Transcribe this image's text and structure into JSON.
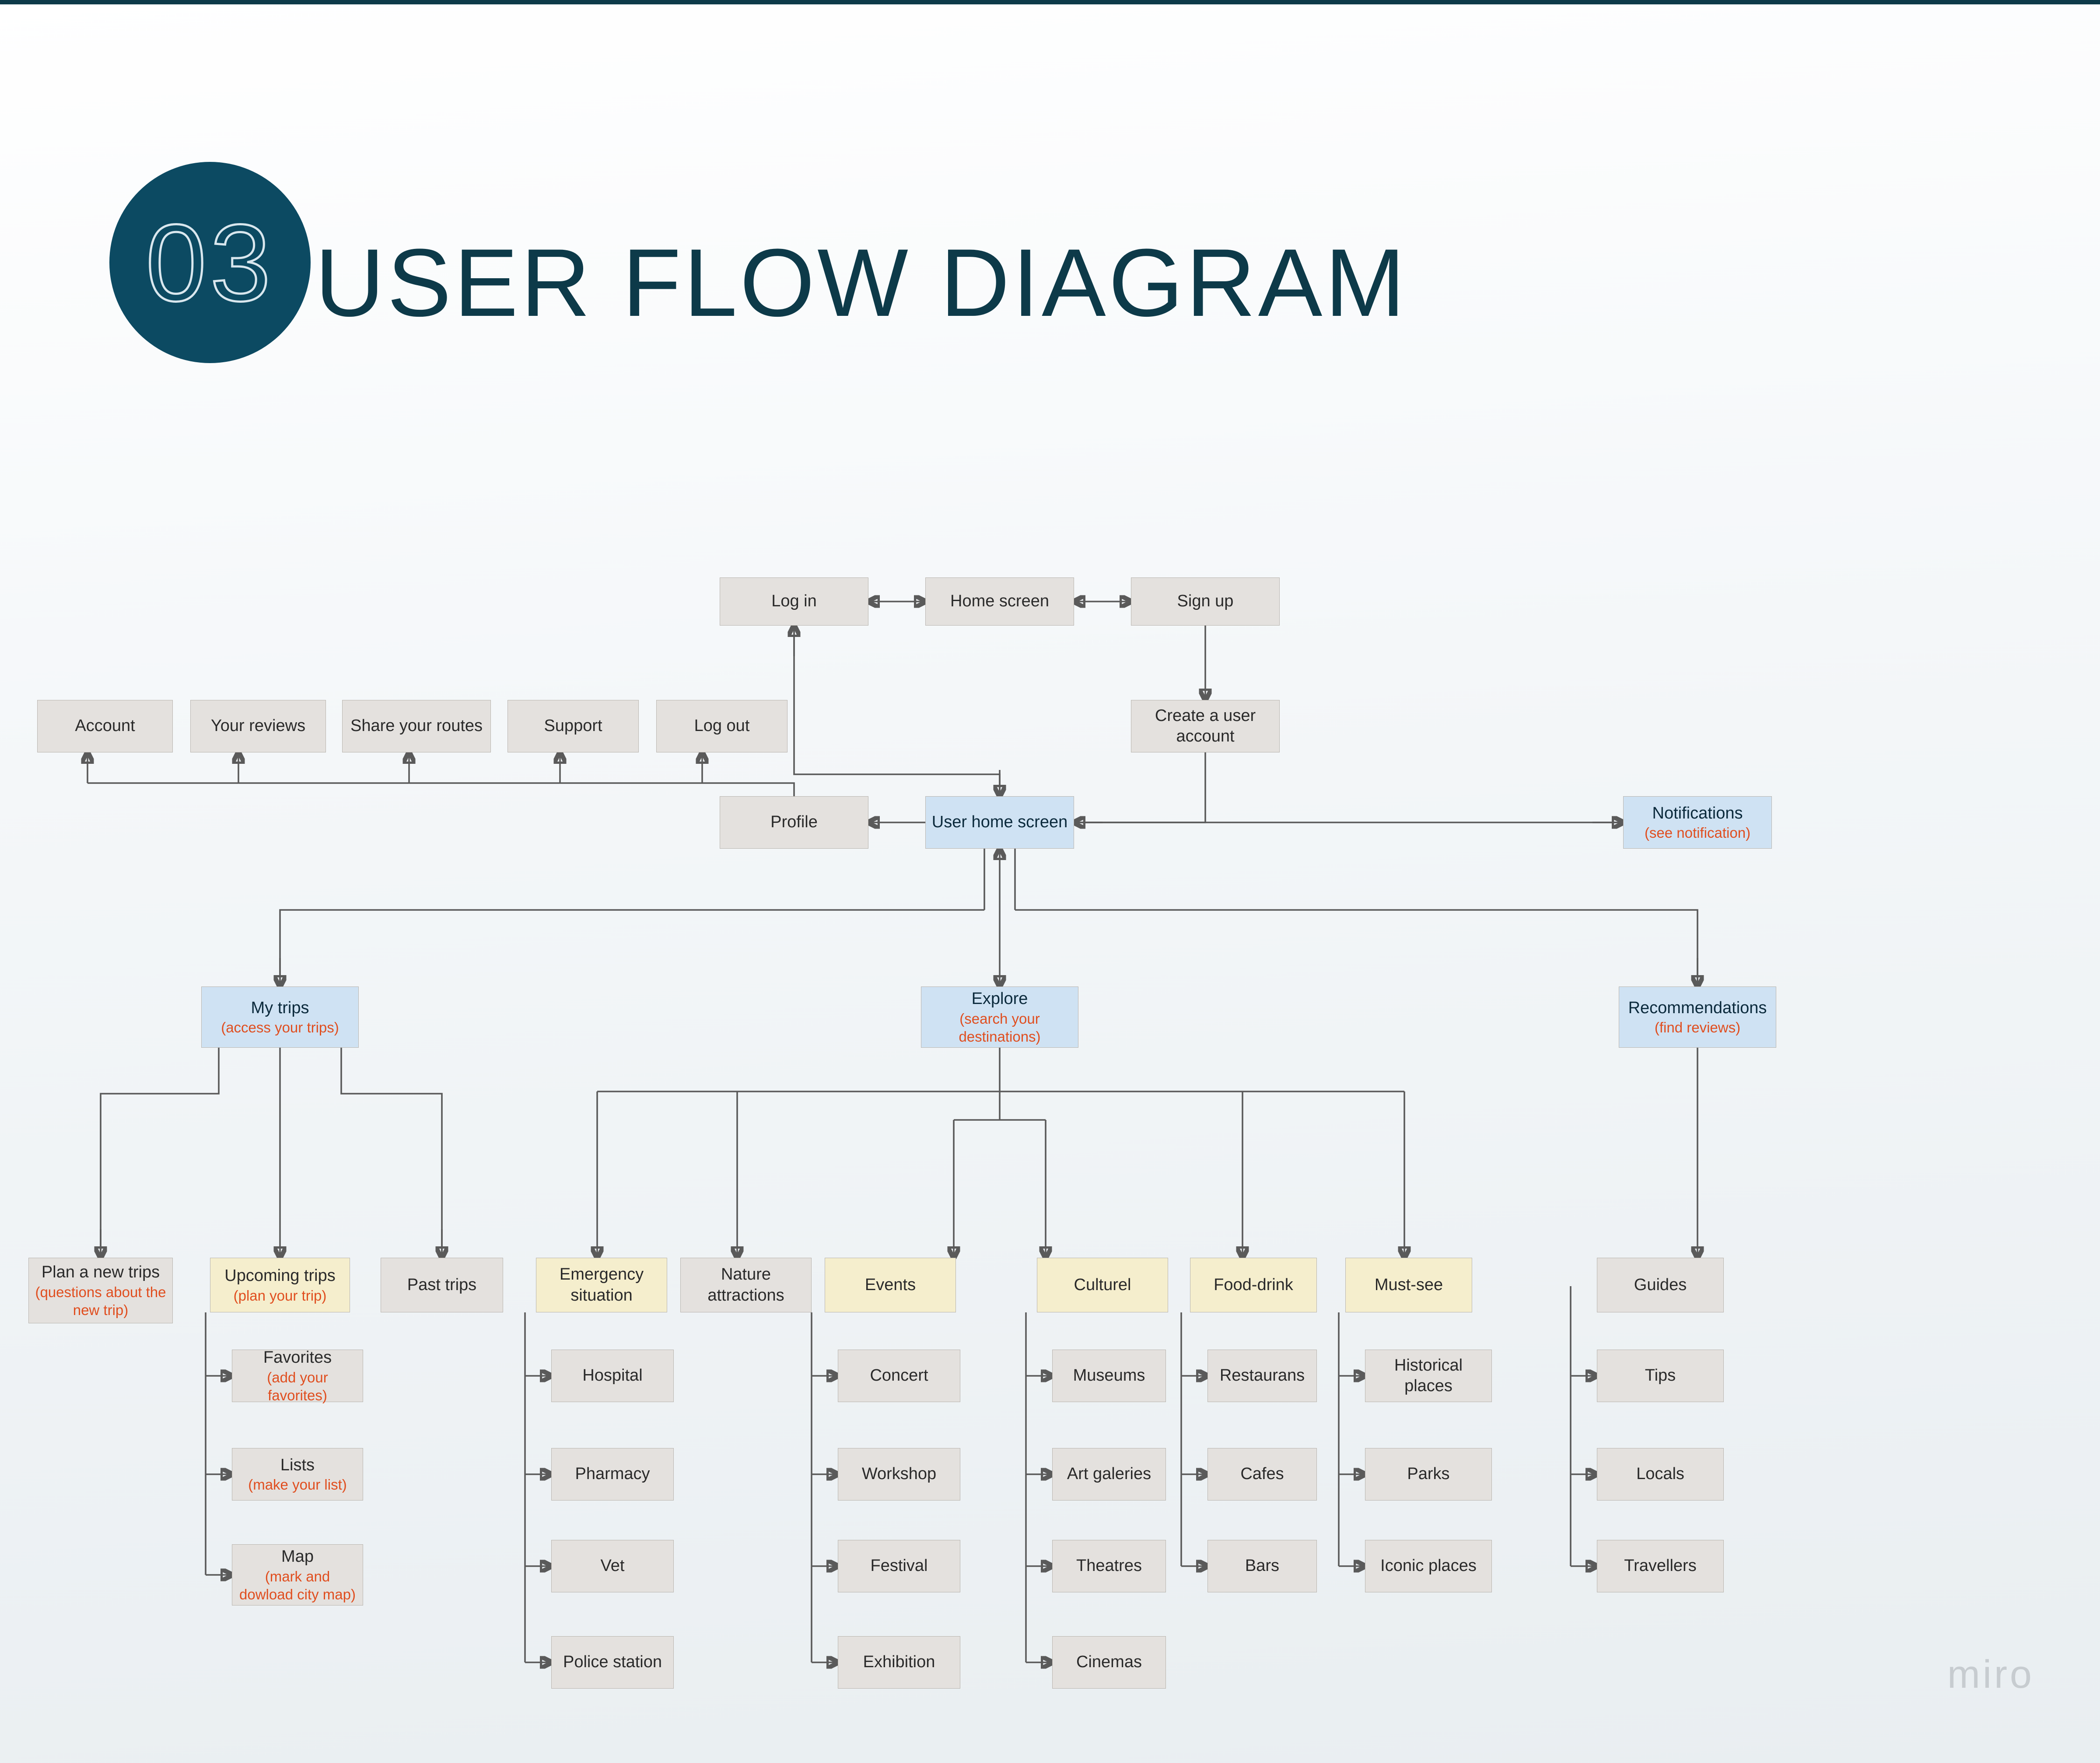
{
  "header": {
    "badge": "03",
    "title": "USER FLOW DIAGRAM"
  },
  "watermark": "miro",
  "colors": {
    "grey": "#e4e1de",
    "blue": "#cfe2f3",
    "cream": "#f5eecd",
    "sub": "#e04e1f",
    "dark": "#0d3a49"
  },
  "nodes": {
    "login": {
      "label": "Log in"
    },
    "home": {
      "label": "Home screen"
    },
    "signup": {
      "label": "Sign up"
    },
    "create": {
      "label": "Create a user account"
    },
    "account": {
      "label": "Account"
    },
    "reviews": {
      "label": "Your reviews"
    },
    "share": {
      "label": "Share your routes"
    },
    "support": {
      "label": "Support"
    },
    "logout": {
      "label": "Log out"
    },
    "profile": {
      "label": "Profile"
    },
    "userhome": {
      "label": "User home screen"
    },
    "notifications": {
      "label": "Notifications",
      "sub": "(see notification)"
    },
    "mytrips": {
      "label": "My trips",
      "sub": "(access your trips)"
    },
    "explore": {
      "label": "Explore",
      "sub": "(search your destinations)"
    },
    "recommend": {
      "label": "Recommendations",
      "sub": "(find reviews)"
    },
    "plan": {
      "label": "Plan a new trips",
      "sub": "(questions about the new trip)"
    },
    "upcoming": {
      "label": "Upcoming trips",
      "sub": "(plan your trip)"
    },
    "past": {
      "label": "Past trips"
    },
    "favorites": {
      "label": "Favorites",
      "sub": "(add your favorites)"
    },
    "lists": {
      "label": "Lists",
      "sub": "(make your list)"
    },
    "map": {
      "label": "Map",
      "sub": "(mark and dowload city map)"
    },
    "emergency": {
      "label": "Emergency situation"
    },
    "nature": {
      "label": "Nature attractions"
    },
    "events": {
      "label": "Events"
    },
    "culturel": {
      "label": "Culturel"
    },
    "food": {
      "label": "Food-drink"
    },
    "mustsee": {
      "label": "Must-see"
    },
    "hospital": {
      "label": "Hospital"
    },
    "pharmacy": {
      "label": "Pharmacy"
    },
    "vet": {
      "label": "Vet"
    },
    "police": {
      "label": "Police station"
    },
    "concert": {
      "label": "Concert"
    },
    "workshop": {
      "label": "Workshop"
    },
    "festival": {
      "label": "Festival"
    },
    "exhibition": {
      "label": "Exhibition"
    },
    "museums": {
      "label": "Museums"
    },
    "galeries": {
      "label": "Art galeries"
    },
    "theatres": {
      "label": "Theatres"
    },
    "cinemas": {
      "label": "Cinemas"
    },
    "restaurans": {
      "label": "Restaurans"
    },
    "cafes": {
      "label": "Cafes"
    },
    "bars": {
      "label": "Bars"
    },
    "historical": {
      "label": "Historical places"
    },
    "parks": {
      "label": "Parks"
    },
    "iconic": {
      "label": "Iconic places"
    },
    "guides": {
      "label": "Guides"
    },
    "tips": {
      "label": "Tips"
    },
    "locals": {
      "label": "Locals"
    },
    "travellers": {
      "label": "Travellers"
    }
  }
}
